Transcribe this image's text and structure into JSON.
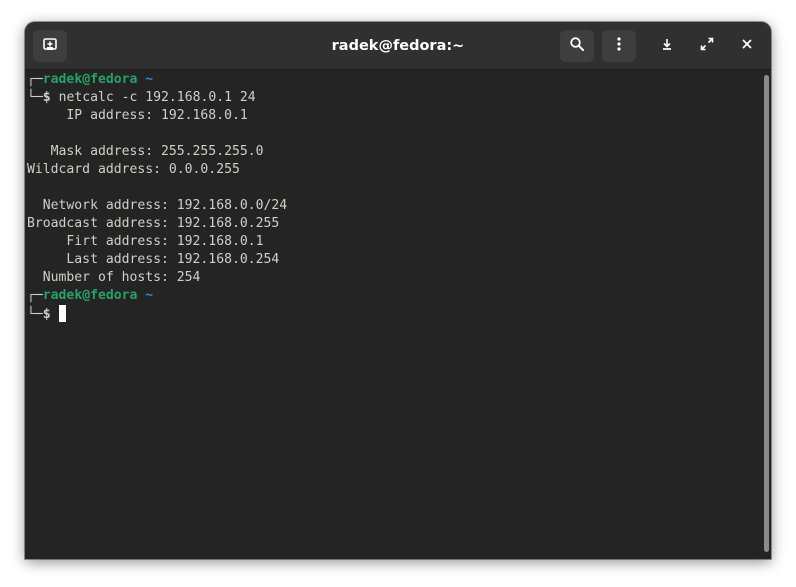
{
  "window": {
    "title": "radek@fedora:~"
  },
  "header": {
    "new_tab_icon": "new-tab-icon",
    "search_icon": "search-icon",
    "menu_icon": "vertical-dots-icon",
    "minimize_icon": "minimize-icon",
    "maximize_icon": "maximize-icon",
    "close_icon": "close-icon"
  },
  "colors": {
    "prompt_user": "#26a269",
    "prompt_tilde": "#3584e4",
    "terminal_bg": "#242424",
    "terminal_fg": "#d0cfcc"
  },
  "terminal": {
    "prompt1": {
      "box_top": "┌─",
      "user_host": "radek@fedora",
      "tilde": "~",
      "box_bottom": "└─",
      "dollar": "$",
      "command": "netcalc -c 192.168.0.1 24"
    },
    "output": [
      "     IP address: 192.168.0.1",
      "",
      "   Mask address: 255.255.255.0",
      "Wildcard address: 0.0.0.255",
      "",
      "  Network address: 192.168.0.0/24",
      "Broadcast address: 192.168.0.255",
      "     Firt address: 192.168.0.1",
      "     Last address: 192.168.0.254",
      "  Number of hosts: 254"
    ],
    "prompt2": {
      "box_top": "┌─",
      "user_host": "radek@fedora",
      "tilde": "~",
      "box_bottom": "└─",
      "dollar": "$"
    }
  }
}
